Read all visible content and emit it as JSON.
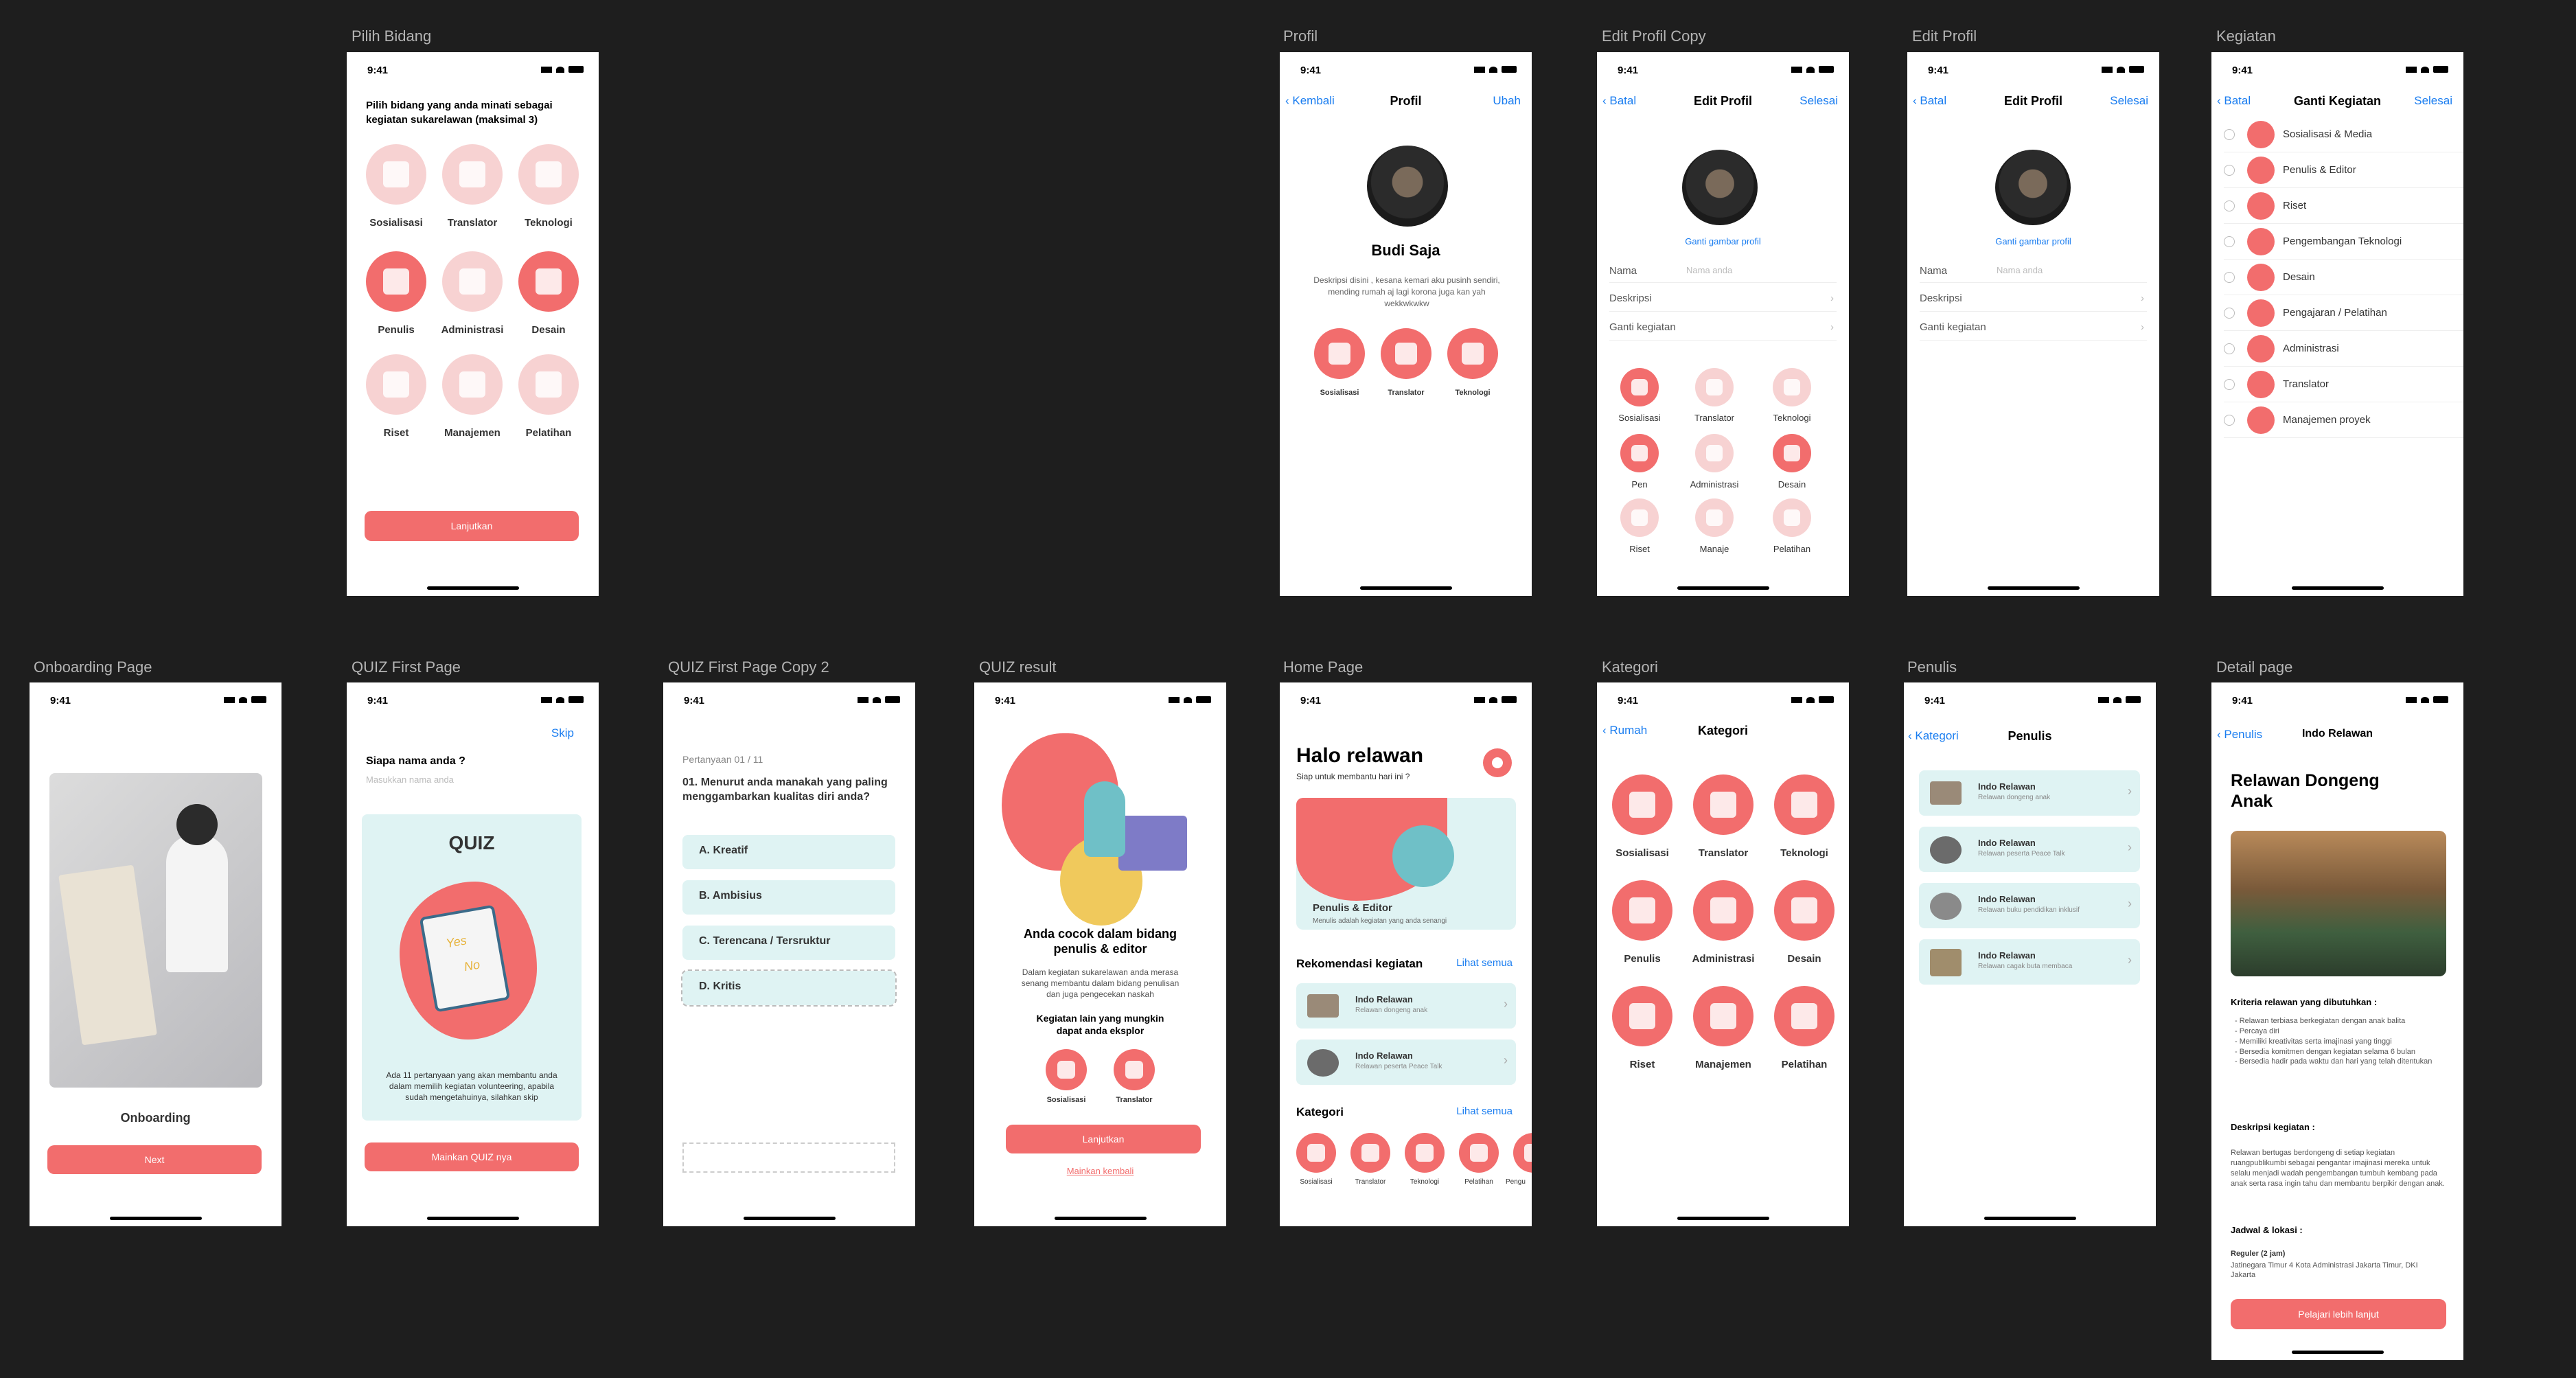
{
  "status_time": "9:41",
  "frames": {
    "pilih_bidang": "Pilih Bidang",
    "profil": "Profil",
    "edit_profil_copy": "Edit Profil Copy",
    "edit_profil": "Edit Profil",
    "kegiatan": "Kegiatan",
    "onboarding": "Onboarding Page",
    "quiz_first": "QUIZ First Page",
    "quiz_first_copy": "QUIZ First Page Copy 2",
    "quiz_result": "QUIZ result",
    "home": "Home Page",
    "kategori": "Kategori",
    "penulis": "Penulis",
    "detail": "Detail page"
  },
  "pilih_bidang": {
    "title": "Pilih bidang yang anda minati sebagai kegiatan sukarelawan (maksimal 3)",
    "items": [
      "Sosialisasi",
      "Translator",
      "Teknologi",
      "Penulis",
      "Administrasi",
      "Desain",
      "Riset",
      "Manajemen",
      "Pelatihan"
    ],
    "button": "Lanjutkan"
  },
  "profil": {
    "back": "Kembali",
    "title": "Profil",
    "action": "Ubah",
    "name": "Budi Saja",
    "desc": "Deskripsi disini , kesana kemari aku pusinh sendiri, mending rumah aj lagi korona juga kan yah wekkwkwkw",
    "tags": [
      "Sosialisasi",
      "Translator",
      "Teknologi"
    ]
  },
  "edit_copy": {
    "back": "Batal",
    "title": "Edit Profil",
    "action": "Selesai",
    "change_photo": "Ganti gambar profil",
    "name_label": "Nama",
    "name_placeholder": "Nama anda",
    "desc_label": "Deskripsi",
    "activity_label": "Ganti kegiatan",
    "items": [
      "Sosialisasi",
      "Translator",
      "Teknologi",
      "Pen",
      "Administrasi",
      "Desain",
      "Riset",
      "Manaje",
      "Pelatihan"
    ]
  },
  "edit": {
    "back": "Batal",
    "title": "Edit Profil",
    "action": "Selesai",
    "change_photo": "Ganti gambar profil",
    "name_label": "Nama",
    "name_placeholder": "Nama anda",
    "desc_label": "Deskripsi",
    "activity_label": "Ganti kegiatan"
  },
  "kegiatan": {
    "back": "Batal",
    "title": "Ganti Kegiatan",
    "action": "Selesai",
    "items": [
      "Sosialisasi & Media",
      "Penulis & Editor",
      "Riset",
      "Pengembangan Teknologi",
      "Desain",
      "Pengajaran / Pelatihan",
      "Administrasi",
      "Translator",
      "Manajemen proyek"
    ]
  },
  "onboarding": {
    "title": "Onboarding",
    "button": "Next"
  },
  "quiz_first": {
    "skip": "Skip",
    "question": "Siapa nama anda ?",
    "placeholder": "Masukkan nama anda",
    "quiz_title": "QUIZ",
    "yes": "Yes",
    "no": "No",
    "desc": "Ada 11 pertanyaan yang akan membantu anda dalam memilih kegiatan volunteering, apabila sudah mengetahuinya, silahkan skip",
    "button": "Mainkan QUIZ nya"
  },
  "quiz_copy": {
    "progress": "Pertanyaan 01 / 11",
    "question": "01. Menurut anda manakah yang paling menggambarkan kualitas diri anda?",
    "options": [
      "A. Kreatif",
      "B. Ambisius",
      "C. Terencana / Tersruktur",
      "D. Kritis"
    ]
  },
  "quiz_result": {
    "title": "Anda cocok dalam bidang penulis & editor",
    "desc": "Dalam kegiatan sukarelawan anda merasa senang membantu dalam bidang penulisan dan juga pengecekan naskah",
    "other": "Kegiatan lain yang mungkin dapat anda eksplor",
    "tags": [
      "Sosialisasi",
      "Translator"
    ],
    "button": "Lanjutkan",
    "link": "Mainkan kembali"
  },
  "home": {
    "greeting": "Halo relawan",
    "sub": "Siap untuk membantu hari ini ?",
    "banner_title": "Penulis & Editor",
    "banner_sub": "Menulis adalah kegiatan yang anda senangi",
    "rec_title": "Rekomendasi kegiatan",
    "see_all": "Lihat semua",
    "recs": [
      {
        "title": "Indo Relawan",
        "sub": "Relawan dongeng anak"
      },
      {
        "title": "Indo Relawan",
        "sub": "Relawan peserta Peace Talk"
      }
    ],
    "cat_title": "Kategori",
    "cat_see_all": "Lihat semua",
    "cats": [
      "Sosialisasi",
      "Translator",
      "Teknologi",
      "Pelatihan",
      "Pengu"
    ]
  },
  "kategori": {
    "back": "Rumah",
    "title": "Kategori",
    "items": [
      "Sosialisasi",
      "Translator",
      "Teknologi",
      "Penulis",
      "Administrasi",
      "Desain",
      "Riset",
      "Manajemen",
      "Pelatihan"
    ]
  },
  "penulis": {
    "back": "Kategori",
    "title": "Penulis",
    "items": [
      {
        "title": "Indo Relawan",
        "sub": "Relawan dongeng anak"
      },
      {
        "title": "Indo Relawan",
        "sub": "Relawan peserta Peace Talk"
      },
      {
        "title": "Indo Relawan",
        "sub": "Relawan buku pendidikan inklusif"
      },
      {
        "title": "Indo Relawan",
        "sub": "Relawan cagak buta membaca"
      }
    ]
  },
  "detail": {
    "back": "Penulis",
    "nav_title": "Indo Relawan",
    "title": "Relawan Dongeng Anak",
    "criteria_title": "Kriteria relawan yang dibutuhkan :",
    "criteria": [
      "- Relawan terbiasa berkegiatan dengan anak balita",
      "- Percaya diri",
      "- Memiliki kreativitas serta imajinasi yang tinggi",
      "- Bersedia komitmen dengan kegiatan selama 6 bulan",
      "- Bersedia hadir pada waktu dan hari yang telah ditentukan"
    ],
    "desc_title": "Deskripsi kegiatan :",
    "desc": "Relawan bertugas berdongeng di setiap kegiatan ruangpublikumbi sebagai pengantar imajinasi mereka untuk selalu menjadi wadah pengembangan tumbuh kembang pada anak serta rasa ingin tahu dan membantu berpikir dengan anak.",
    "schedule_title": "Jadwal & lokasi :",
    "schedule_type": "Reguler (2 jam)",
    "schedule_loc": "Jatinegara Timur 4 Kota Administrasi Jakarta Timur, DKI Jakarta",
    "button": "Pelajari lebih lanjut"
  }
}
